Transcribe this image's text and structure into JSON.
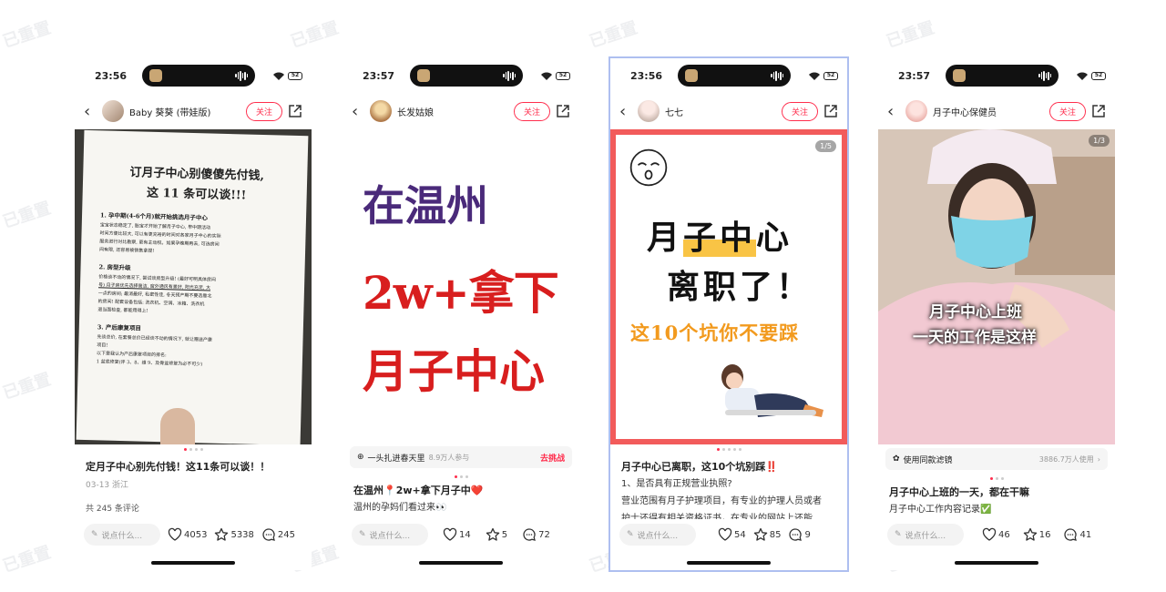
{
  "watermark": "已重置",
  "ui": {
    "comment_placeholder": "说点什么..."
  },
  "posts": [
    {
      "time": "23:56",
      "battery": "52",
      "author": "Baby 葵葵 (带娃版)",
      "follow": "关注",
      "title": "定月子中心别先付钱！这11条可以谈！！",
      "meta": "03-13 浙江",
      "comment_count_text": "共 245 条评论",
      "likes": "4053",
      "stars": "5338",
      "comments": "245",
      "image": {
        "heading_1": "订月子中心别傻傻先付钱,",
        "heading_2": "这 11 条可以谈!!!",
        "s1": "1. 孕中期(4-6个月)就开始挑选月子中心",
        "p1a": "宝宝状态稳定了, 胎宝才开始了解月子中心, 早中期活动",
        "p1b": "时间方便比较大, 可以有更充裕的时间对各家月子中心的实际",
        "p1c": "服务进行对比勘察, 更有主动权。如果孕晚期再去, 可选房间",
        "p1d": "间有限, 还容易被销售拿捏!",
        "s2": "2. 房型升级",
        "p2a": "价格谈不动的情况下, 尝试谈房型升级! (最好可明具体房间",
        "p2b": "号) 月子房优先选择简洁, 窗外通风有景好, 阳光充足, 大",
        "p2c": "一点的房间; 最消最好, 私密性佳, 冬天预产期不要选靠北",
        "p2d": "的房间! 配套设备包括: 洗衣机、空调、冰箱、洗衣机",
        "p2e": "退当面检查, 都能用得上!",
        "s3": "3. 产后康复项目",
        "p3a": "先谈总价, 在套餐总价已经谈不动的情况下, 就让赠送产康",
        "p3b": "项目!",
        "p3c": "以下是我认为产后康复项目的排名:",
        "p3d": "1 盆底修复(评 3、8、维 9、及骨盆修复为必不可少)"
      }
    },
    {
      "time": "23:57",
      "battery": "52",
      "author": "长发姑娘",
      "follow": "关注",
      "image": {
        "line1": "在温州",
        "line2": "2w+拿下",
        "line3": "月子中心"
      },
      "chip": {
        "text": "一头扎进春天里",
        "count": "8.9万人参与",
        "action": "去挑战"
      },
      "title": "在温州📍2w+拿下月子中❤️",
      "body": "温州的孕妈们看过来👀",
      "likes": "14",
      "stars": "5",
      "comments": "72"
    },
    {
      "time": "23:56",
      "battery": "52",
      "author": "七七",
      "follow": "关注",
      "counter": "1/5",
      "image": {
        "line1a": "月",
        "line1b": "子中",
        "line1c": "心",
        "line2": "离职了！",
        "line3": "这10个坑你不要踩"
      },
      "title": "月子中心已离职，这10个坑别踩‼️",
      "body1": "1、是否具有正规营业执照?",
      "body2": "营业范围有月子护理项目，有专业的护理人员或者",
      "body3": "护士还得有相关资格证书，在专业的网站上还能",
      "likes": "54",
      "stars": "85",
      "comments": "9"
    },
    {
      "time": "23:57",
      "battery": "52",
      "author": "月子中心保健员",
      "follow": "关注",
      "counter": "1/3",
      "image": {
        "caption1": "月子中心上班",
        "caption2": "一天的工作是这样"
      },
      "chip": {
        "text": "使用同款滤镜",
        "count": "3886.7万人使用",
        "action": "›"
      },
      "title": "月子中心上班的一天，都在干嘛",
      "body": "月子中心工作内容记录✅",
      "likes": "46",
      "stars": "16",
      "comments": "41"
    }
  ]
}
